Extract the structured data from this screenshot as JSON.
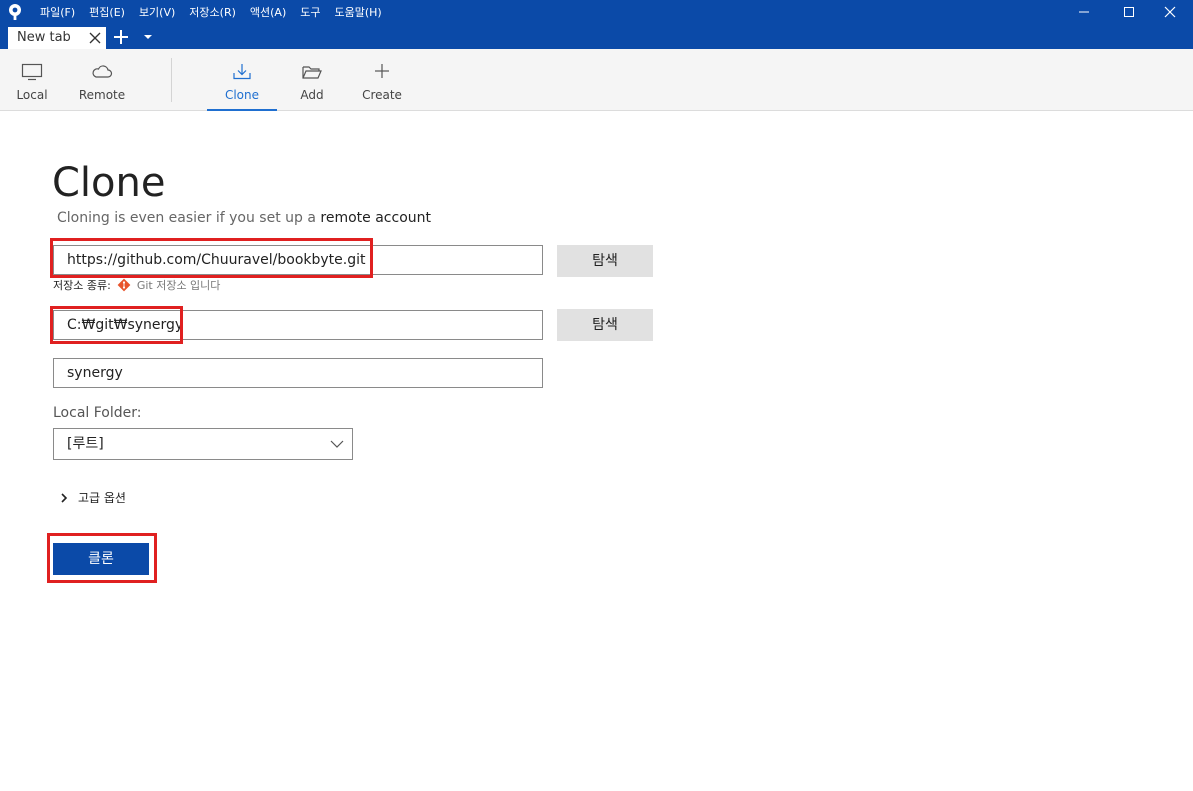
{
  "menu": {
    "items": [
      "파일(F)",
      "편집(E)",
      "보기(V)",
      "저장소(R)",
      "액션(A)",
      "도구",
      "도움말(H)"
    ]
  },
  "tabs": {
    "active_label": "New tab"
  },
  "toolbar": {
    "local": "Local",
    "remote": "Remote",
    "clone": "Clone",
    "add": "Add",
    "create": "Create"
  },
  "clone_form": {
    "title": "Clone",
    "subtitle_prefix": "Cloning is even easier if you set up a",
    "subtitle_link": "remote account",
    "source_url": "https://github.com/Chuuravel/bookbyte.git",
    "browse_label": "탐색",
    "repo_type_label": "저장소 종류:",
    "repo_type_value": "Git 저장소 입니다",
    "destination_path": "C:₩git₩synergy",
    "browse_label_2": "탐색",
    "name": "synergy",
    "local_folder_label": "Local Folder:",
    "local_folder_value": "[루트]",
    "advanced_options": "고급 옵션",
    "clone_button": "클론"
  },
  "colors": {
    "accent": "#0b4aa8",
    "highlight": "#e02020",
    "active_tab": "#1f6fd0"
  }
}
